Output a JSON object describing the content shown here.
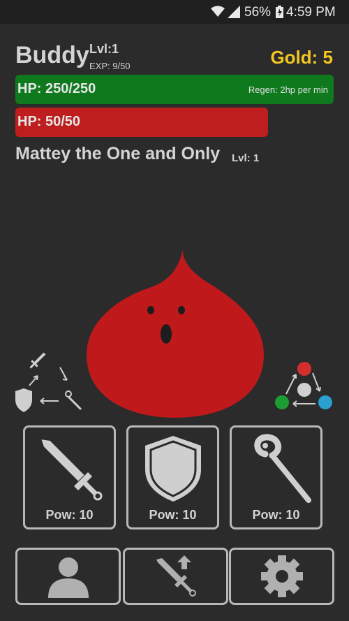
{
  "status_bar": {
    "battery_percent": "56%",
    "time": "4:59 PM",
    "icons": [
      "wifi-icon",
      "signal-icon",
      "battery-icon"
    ]
  },
  "player": {
    "name": "Buddy",
    "level": "Lvl:1",
    "exp": "EXP: 9/50",
    "gold": "Gold: 5",
    "hp_text": "HP: 250/250",
    "hp_fraction": 1.0,
    "regen": "Regen: 2hp per min"
  },
  "enemy": {
    "hp_text": "HP: 50/50",
    "hp_fraction": 1.0,
    "name": "Mattey the One and Only",
    "level": "Lvl: 1"
  },
  "actions": [
    {
      "icon": "sword-icon",
      "label": "Pow: 10"
    },
    {
      "icon": "shield-icon",
      "label": "Pow: 10"
    },
    {
      "icon": "staff-icon",
      "label": "Pow: 10"
    }
  ],
  "nav": [
    {
      "icon": "profile-icon"
    },
    {
      "icon": "upgrade-sword-icon"
    },
    {
      "icon": "settings-gear-icon"
    }
  ],
  "colors": {
    "background": "#2b2b2b",
    "player_hp": "#0f7a1d",
    "enemy_hp": "#be1e1e",
    "gold": "#f3c623",
    "monster": "#c0191c"
  }
}
